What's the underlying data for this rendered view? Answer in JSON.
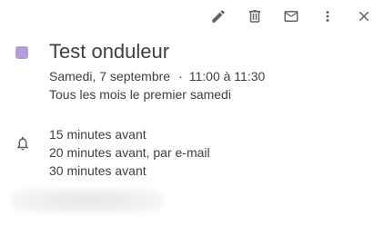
{
  "toolbar": {
    "buttons": [
      {
        "name": "edit-button",
        "icon": "pencil-icon"
      },
      {
        "name": "delete-button",
        "icon": "trash-icon"
      },
      {
        "name": "email-button",
        "icon": "mail-icon"
      },
      {
        "name": "more-options-button",
        "icon": "more-vert-icon"
      },
      {
        "name": "close-button",
        "icon": "close-icon"
      }
    ]
  },
  "event": {
    "color": "#b39ddb",
    "title": "Test onduleur",
    "date": "Samedi, 7 septembre",
    "separator": "·",
    "time": "11:00 à 11:30",
    "recurrence": "Tous les mois le premier samedi"
  },
  "notifications": {
    "icon": "bell-icon",
    "items": [
      "15 minutes avant",
      "20 minutes avant, par e-mail",
      "30 minutes avant"
    ]
  },
  "calendar_owner": {
    "redacted": true
  },
  "colors": {
    "icon": "#5f6368",
    "text": "#3c4043"
  }
}
